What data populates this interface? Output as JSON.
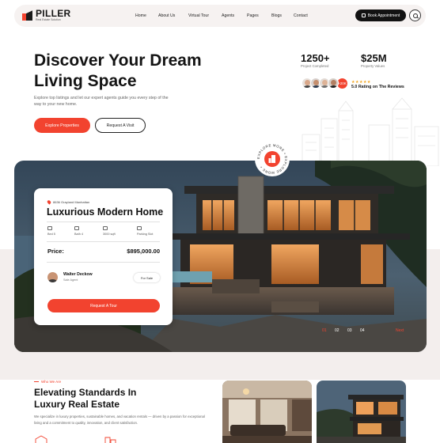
{
  "brand": {
    "name": "PILLER",
    "tagline": "Real Estate Solution",
    "accent": "#f2432f"
  },
  "nav": {
    "links": [
      "Home",
      "About Us",
      "Virtual Tour",
      "Agents",
      "Pages",
      "Blogs",
      "Contact"
    ],
    "book_label": "Book Appointment",
    "search_icon": "search-icon"
  },
  "hero": {
    "title_line1": "Discover Your Dream",
    "title_line2": "Living Space",
    "description": "Explore top listings and let our expert agents guide you every step of the way to your new home.",
    "explore_label": "Explore Properties",
    "request_label": "Request A Visit"
  },
  "stats": [
    {
      "value": "1250+",
      "label": "Project Completed"
    },
    {
      "value": "$25M",
      "label": "Property Values"
    }
  ],
  "reviews": {
    "count_badge": "+20K",
    "stars": "★★★★★",
    "rating_text": "5.0 Rating on The Reviews"
  },
  "badge": {
    "text": "EXPLORE MORE • EXPLORE MORE •"
  },
  "property": {
    "location": "8636 Grayland Manhattan",
    "title": "Luxurious Modern Home",
    "features": [
      {
        "icon": "bed-icon",
        "label": "Bed 5"
      },
      {
        "icon": "bath-icon",
        "label": "Bath 4"
      },
      {
        "icon": "area-icon",
        "label": "3000 sqft"
      },
      {
        "icon": "parking-icon",
        "label": "Parking Slot"
      }
    ],
    "price_label": "Price:",
    "price": "$895,000.00",
    "agent_name": "Walter Deckow",
    "agent_role": "Sale Agent",
    "status": "For Sale",
    "tour_label": "Request A Tour"
  },
  "pager": {
    "pages": [
      "01",
      "02",
      "03",
      "04"
    ],
    "active": "01",
    "next_label": "Next"
  },
  "about": {
    "eyebrow": "Who We Are",
    "title_line1": "Elevating Standards In",
    "title_line2": "Luxury Real Estate",
    "description": "We specialize in luxury properties, sustainable homes, and vacation rentals — driven by a passion for exceptional living and a commitment to quality, innovation, and client satisfaction."
  }
}
